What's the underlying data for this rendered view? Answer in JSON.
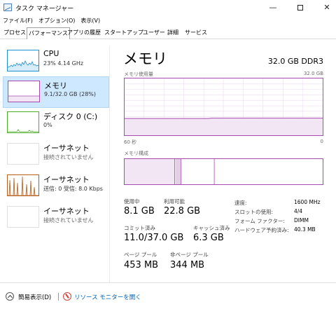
{
  "window": {
    "title": "タスク マネージャー",
    "min_glyph": "—",
    "close_glyph": "✕"
  },
  "menu": [
    {
      "label": "ファイル(F)"
    },
    {
      "label": "オプション(O)"
    },
    {
      "label": "表示(V)"
    }
  ],
  "tabs": [
    {
      "label": "プロセス"
    },
    {
      "label": "パフォーマンス"
    },
    {
      "label": "アプリの履歴"
    },
    {
      "label": "スタートアップ"
    },
    {
      "label": "ユーザー"
    },
    {
      "label": "詳細"
    },
    {
      "label": "サービス"
    }
  ],
  "sidebar": {
    "cpu": {
      "name": "CPU",
      "detail": "23%  4.14 GHz"
    },
    "memory": {
      "name": "メモリ",
      "detail": "9.1/32.0 GB (28%)"
    },
    "disk": {
      "name": "ディスク 0 (C:)",
      "detail": "0%"
    },
    "ethernet1": {
      "name": "イーサネット",
      "detail": "接続されていません"
    },
    "ethernet2": {
      "name": "イーサネット",
      "detail": "送信: 0  受信: 8.0 Kbps"
    },
    "ethernet3": {
      "name": "イーサネット",
      "detail": "接続されていません"
    }
  },
  "main": {
    "title": "メモリ",
    "spec": "32.0 GB DDR3",
    "usage_graph": {
      "label": "メモリ使用量",
      "max": "32.0 GB",
      "time_left": "60 秒",
      "time_right": "0"
    },
    "composition_label": "メモリ構成",
    "stats": {
      "in_use": {
        "label": "使用中",
        "value": "8.1 GB"
      },
      "available": {
        "label": "利用可能",
        "value": "22.8 GB"
      },
      "committed": {
        "label": "コミット済み",
        "value": "11.0/37.0 GB"
      },
      "cached": {
        "label": "キャッシュ済み",
        "value": "6.3 GB"
      },
      "paged_pool": {
        "label": "ページ プール",
        "value": "453 MB"
      },
      "nonpaged_pool": {
        "label": "非ページ プール",
        "value": "344 MB"
      }
    },
    "details": [
      {
        "label": "速度:",
        "value": "1600 MHz"
      },
      {
        "label": "スロットの使用:",
        "value": "4/4"
      },
      {
        "label": "フォーム ファクター:",
        "value": "DIMM"
      },
      {
        "label": "ハードウェア予約済み:",
        "value": "40.3 MB"
      }
    ]
  },
  "bottom": {
    "fewer_details": "簡易表示(D)",
    "resource_monitor": "リソース モニターを開く"
  },
  "colors": {
    "memory_accent": "#a74ab0",
    "cpu_accent": "#1e8fd2",
    "disk_accent": "#4cae26",
    "ethernet_accent": "#b45f1c",
    "selected_bg": "#cde8ff"
  }
}
